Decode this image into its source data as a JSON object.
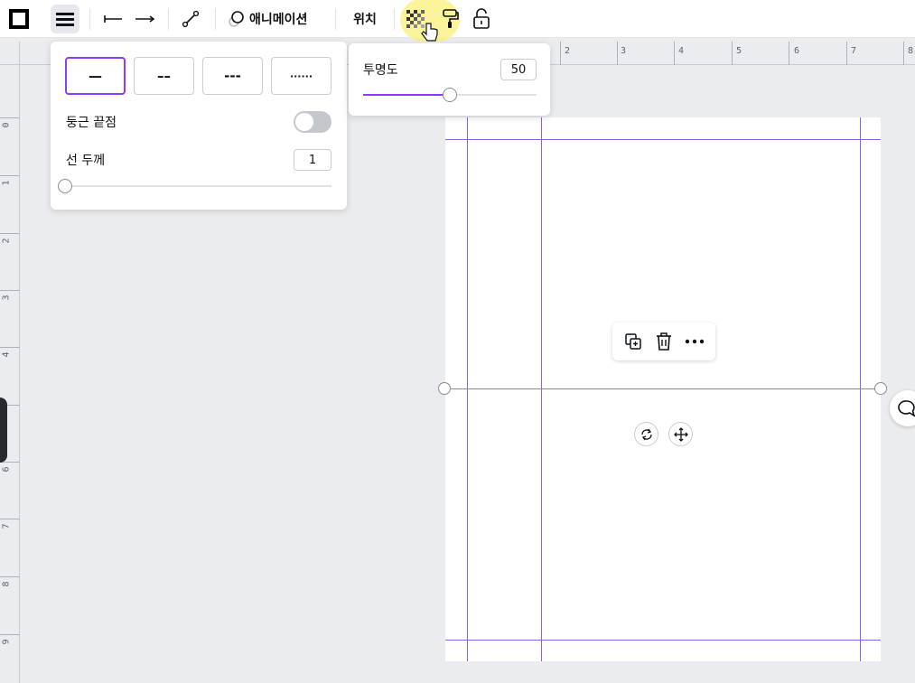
{
  "toolbar": {
    "animate_label": "애니메이션",
    "position_label": "위치"
  },
  "line_panel": {
    "styles": [
      "—",
      "––",
      "---",
      "······"
    ],
    "rounded_ends_label": "둥근 끝점",
    "rounded_ends_on": false,
    "thickness_label": "선 두께",
    "thickness_value": "1"
  },
  "transparency_panel": {
    "label": "투명도",
    "value": "50",
    "level_fraction": 0.5
  },
  "ruler_top": [
    "2",
    "3",
    "4",
    "5",
    "6",
    "7",
    "8"
  ],
  "ruler_left": [
    "0",
    "1",
    "2",
    "3",
    "4",
    "6",
    "7",
    "8",
    "9"
  ],
  "colors": {
    "accent": "#8b3dff",
    "guide": "#8b5cf6"
  }
}
